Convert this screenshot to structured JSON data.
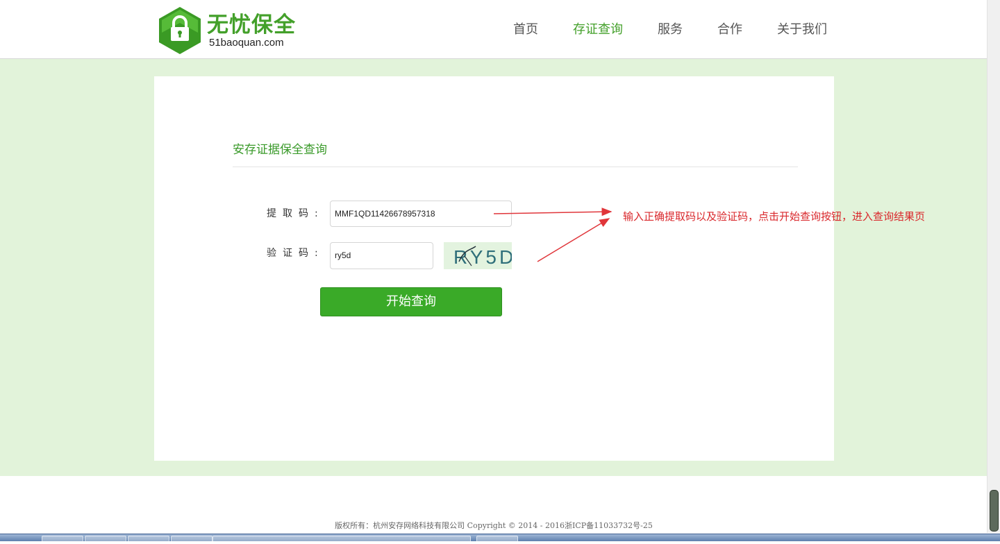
{
  "header": {
    "logo_cn": "无忧保全",
    "logo_en": "51baoquan.com",
    "nav": [
      {
        "label": "首页",
        "active": false
      },
      {
        "label": "存证查询",
        "active": true
      },
      {
        "label": "服务",
        "active": false
      },
      {
        "label": "合作",
        "active": false
      },
      {
        "label": "关于我们",
        "active": false
      }
    ]
  },
  "form": {
    "title": "安存证据保全查询",
    "code_label": "提取码:",
    "code_value": "MMF1QD11426678957318",
    "captcha_label": "验证码:",
    "captcha_value": "ry5d",
    "captcha_image_text": "RY5D",
    "submit_label": "开始查询"
  },
  "annotation": "输入正确提取码以及验证码，点击开始查询按钮，进入查询结果页",
  "footer": {
    "copyright": "版权所有：杭州安存网络科技有限公司 Copyright © 2014 - 2016浙ICP备11033732号-25"
  },
  "colors": {
    "brand_green": "#43a02a",
    "band_bg": "#e2f3da",
    "button": "#3aaa28",
    "annotation_red": "#d9272b"
  }
}
